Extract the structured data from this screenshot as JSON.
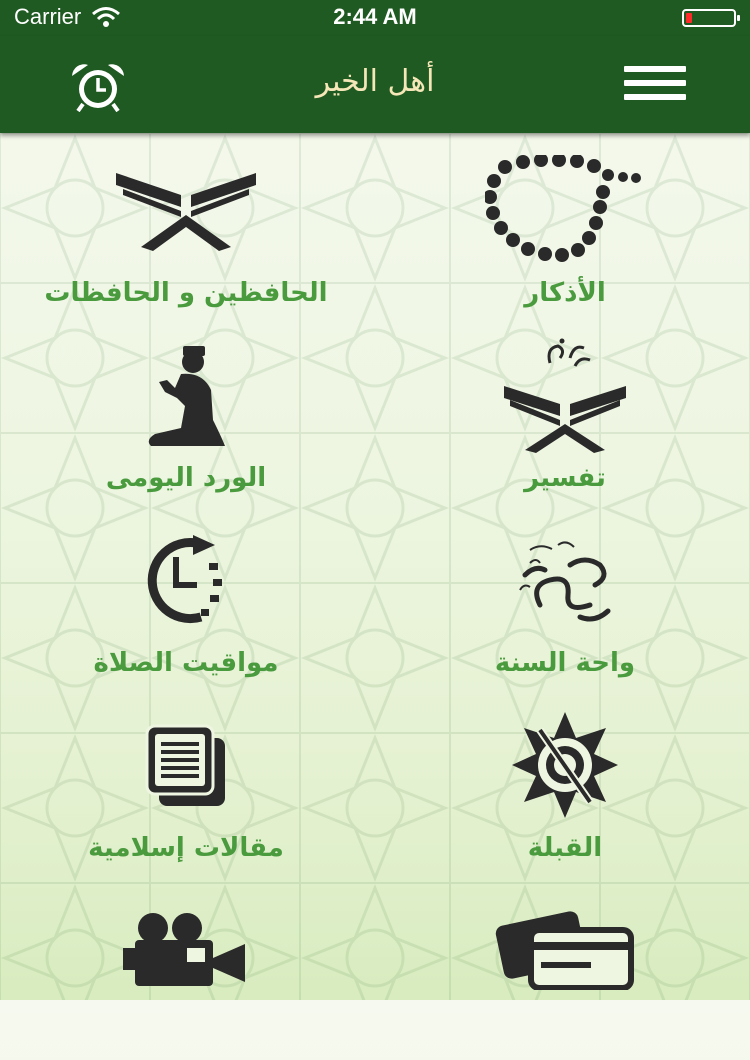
{
  "status_bar": {
    "carrier": "Carrier",
    "time": "2:44 AM"
  },
  "navbar": {
    "title": "أهل الخير",
    "left_icon": "alarm-clock-icon",
    "right_icon": "menu-icon"
  },
  "colors": {
    "bar_green": "#1f5a22",
    "title_gold": "#f6e7b8",
    "label_green": "#4a9a3e",
    "icon_dark": "#2a2a2a"
  },
  "grid": {
    "items": [
      {
        "label": "الأذكار",
        "icon": "prayer-beads-icon"
      },
      {
        "label": "الحافظين و الحافظات",
        "icon": "quran-stand-icon"
      },
      {
        "label": "تفسير",
        "icon": "quran-tafsir-icon"
      },
      {
        "label": "الورد اليومى",
        "icon": "praying-man-icon"
      },
      {
        "label": "واحة السنة",
        "icon": "muhammad-calligraphy-icon"
      },
      {
        "label": "مواقيت الصلاة",
        "icon": "prayer-time-clock-icon"
      },
      {
        "label": "القبلة",
        "icon": "qibla-compass-icon"
      },
      {
        "label": "مقالات إسلامية",
        "icon": "articles-icon"
      },
      {
        "label": "",
        "icon": "payment-cards-icon"
      },
      {
        "label": "",
        "icon": "video-camera-icon"
      }
    ]
  }
}
